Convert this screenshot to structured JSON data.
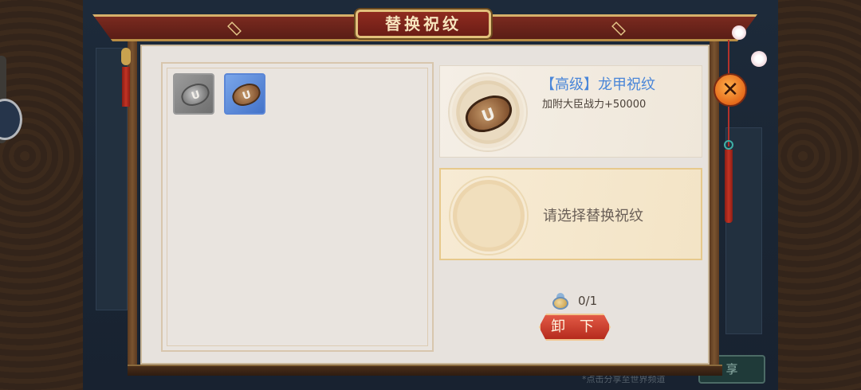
{
  "window": {
    "title": "替换祝纹"
  },
  "inventory": {
    "items": [
      {
        "name": "grey-rune",
        "rarity": "normal",
        "glyph": "U"
      },
      {
        "name": "brown-rune",
        "rarity": "advanced",
        "glyph": "U"
      }
    ]
  },
  "current_rune": {
    "name": "【高级】龙甲祝纹",
    "effect": "加附大臣战力+50000",
    "glyph": "U"
  },
  "replacement": {
    "prompt": "请选择替换祝纹"
  },
  "cost": {
    "amount": "0/1"
  },
  "actions": {
    "unequip_label": "卸 下",
    "close_label": "✕"
  },
  "background": {
    "share_label": "享",
    "hint": "*点击分享至世界频道"
  },
  "colors": {
    "rune_name": "#4a86d8",
    "unequip_button": "#c9392a",
    "close_button": "#f08a2b",
    "panel": "#e7e2dd"
  }
}
